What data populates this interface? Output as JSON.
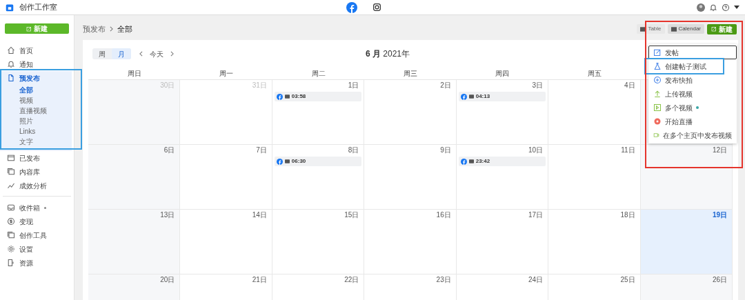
{
  "app": {
    "title": "创作工作室"
  },
  "sidebar": {
    "create_button": "新建",
    "items": [
      {
        "label": "首页",
        "selected": false
      },
      {
        "label": "通知",
        "selected": false
      },
      {
        "label": "预发布",
        "selected": true,
        "expanded": true,
        "children": [
          {
            "label": "全部",
            "selected": true
          },
          {
            "label": "视频",
            "selected": false
          },
          {
            "label": "直播视频",
            "selected": false
          },
          {
            "label": "照片",
            "selected": false
          },
          {
            "label": "Links",
            "selected": false
          },
          {
            "label": "文字",
            "selected": false
          }
        ]
      },
      {
        "label": "已发布",
        "selected": false
      },
      {
        "label": "内容库",
        "selected": false
      },
      {
        "label": "成效分析",
        "selected": false,
        "divider_after": true
      },
      {
        "label": "收件箱",
        "selected": false,
        "dot": true
      },
      {
        "label": "变现",
        "selected": false
      },
      {
        "label": "创作工具",
        "selected": false
      },
      {
        "label": "设置",
        "selected": false
      },
      {
        "label": "资源",
        "selected": false
      }
    ]
  },
  "breadcrumb": [
    "预发布",
    "全部"
  ],
  "view_toggle": [
    {
      "label": "Table",
      "selected": false
    },
    {
      "label": "Calendar",
      "selected": true
    }
  ],
  "create_button": "新建",
  "create_menu": [
    {
      "label": "发帖",
      "selected": true
    },
    {
      "label": "创建帖子测试",
      "selected": false
    },
    {
      "label": "发布快拍",
      "selected": false
    },
    {
      "label": "上传视频",
      "selected": false
    },
    {
      "label": "多个视频",
      "selected": false,
      "dot": true
    },
    {
      "label": "开始直播",
      "selected": false
    },
    {
      "label": "在多个主页中发布视频",
      "selected": false
    }
  ],
  "calendar": {
    "period_tabs": [
      {
        "label": "周",
        "selected": false
      },
      {
        "label": "月",
        "selected": true
      }
    ],
    "today_button": "今天",
    "month_title": "**6 月** 2021年",
    "weekdays": [
      "周日",
      "周一",
      "周二",
      "周三",
      "周四",
      "周五"
    ],
    "weeks": [
      [
        {
          "label": "30日",
          "outside": true,
          "today": false
        },
        {
          "label": "31日",
          "outside": true,
          "today": false
        },
        {
          "label": "1日",
          "today": false,
          "events": [
            {
              "time": "03:58"
            }
          ]
        },
        {
          "label": "2日",
          "today": false
        },
        {
          "label": "3日",
          "today": false,
          "events": [
            {
              "time": "04:13"
            }
          ]
        },
        {
          "label": "4日",
          "today": false
        }
      ],
      [
        {
          "label": "6日",
          "today": false
        },
        {
          "label": "7日",
          "today": false
        },
        {
          "label": "8日",
          "today": false,
          "events": [
            {
              "time": "06:30"
            }
          ]
        },
        {
          "label": "9日",
          "today": false
        },
        {
          "label": "10日",
          "today": false,
          "events": [
            {
              "time": "23:42"
            }
          ]
        },
        {
          "label": "11日",
          "today": false
        },
        {
          "label": "12日",
          "today": false
        }
      ],
      [
        {
          "label": "13日",
          "today": false
        },
        {
          "label": "14日",
          "today": false
        },
        {
          "label": "15日",
          "today": false
        },
        {
          "label": "16日",
          "today": false
        },
        {
          "label": "17日",
          "today": false
        },
        {
          "label": "18日",
          "today": false
        },
        {
          "label": "19日",
          "today": true
        }
      ],
      [
        {
          "label": "20日",
          "today": false
        },
        {
          "label": "21日",
          "today": false
        },
        {
          "label": "22日",
          "today": false
        },
        {
          "label": "23日",
          "today": false
        },
        {
          "label": "24日",
          "today": false
        },
        {
          "label": "25日",
          "today": false
        },
        {
          "label": "26日",
          "today": false
        }
      ]
    ]
  }
}
